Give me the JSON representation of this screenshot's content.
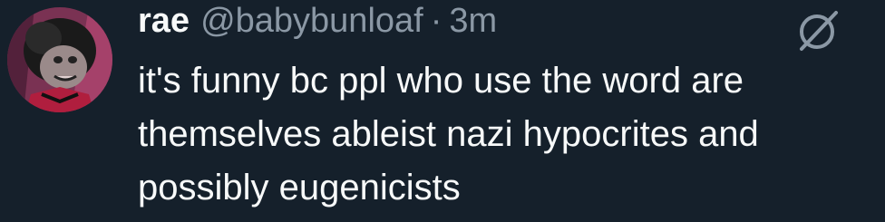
{
  "tweet": {
    "display_name": "rae",
    "handle": "@babybunloaf",
    "separator": "·",
    "timestamp": "3m",
    "text_lines": [
      "it's funny bc ppl who use the word are",
      "themselves ableist nazi hypocrites and",
      "possibly eugenicists"
    ]
  },
  "icons": {
    "avatar": "avatar-image",
    "grok": "grok-icon"
  },
  "colors": {
    "background": "#15202b",
    "primary_text": "#f7f9f9",
    "secondary_text": "#8b98a5"
  }
}
